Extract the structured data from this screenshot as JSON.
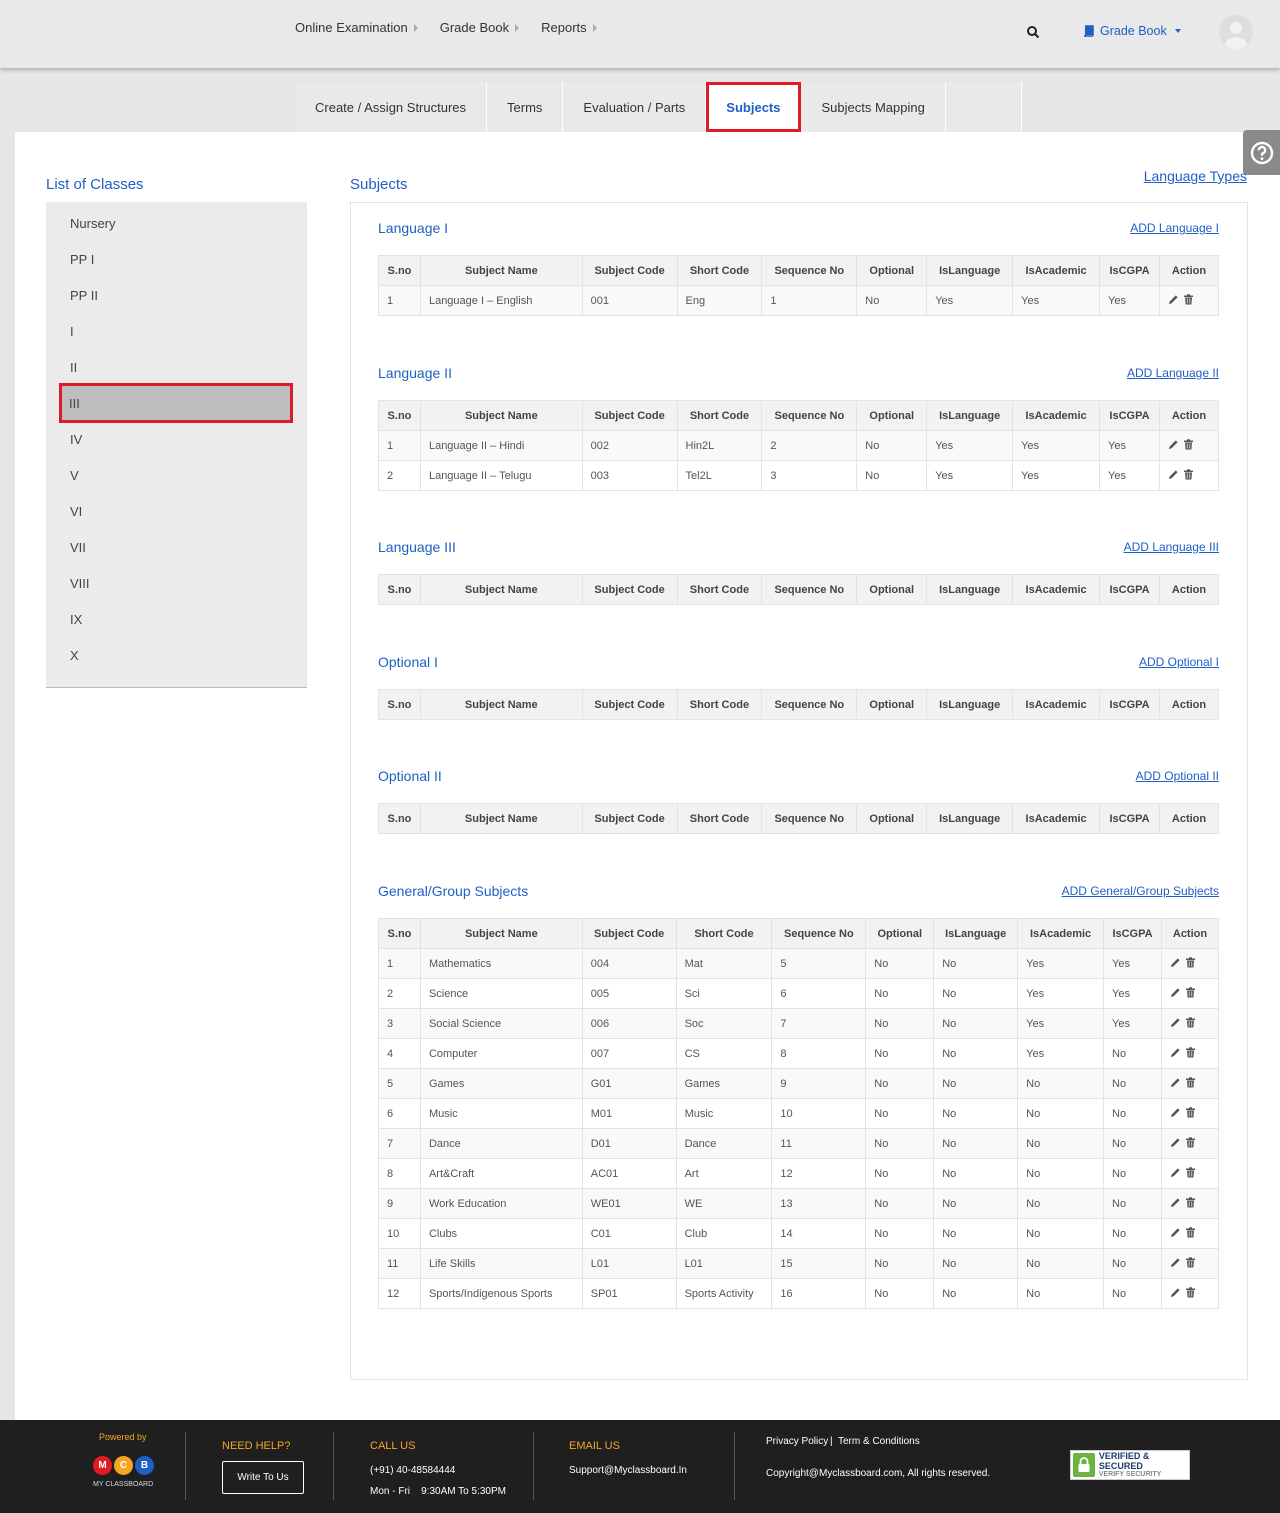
{
  "topnav": {
    "items": [
      "Online Examination",
      "Grade Book",
      "Reports"
    ],
    "gradebook_menu": "Grade Book"
  },
  "tabs": [
    "Create / Assign Structures",
    "Terms",
    "Evaluation / Parts",
    "Subjects",
    "Subjects Mapping"
  ],
  "classes": {
    "title": "List of Classes",
    "items": [
      "Nursery",
      "PP I",
      "PP II",
      "I",
      "II",
      "III",
      "IV",
      "V",
      "VI",
      "VII",
      "VIII",
      "IX",
      "X"
    ],
    "selected": "III"
  },
  "subjects": {
    "title": "Subjects",
    "language_types_link": "Language Types",
    "columns": [
      "S.no",
      "Subject Name",
      "Subject Code",
      "Short Code",
      "Sequence No",
      "Optional",
      "IsLanguage",
      "IsAcademic",
      "IsCGPA",
      "Action"
    ],
    "sections": [
      {
        "title": "Language I",
        "add_link": "ADD Language I",
        "rows": [
          [
            "1",
            "Language I – English",
            "001",
            "Eng",
            "1",
            "No",
            "Yes",
            "Yes",
            "Yes"
          ]
        ]
      },
      {
        "title": "Language II",
        "add_link": "ADD Language II",
        "rows": [
          [
            "1",
            "Language II – Hindi",
            "002",
            "Hin2L",
            "2",
            "No",
            "Yes",
            "Yes",
            "Yes"
          ],
          [
            "2",
            "Language II – Telugu",
            "003",
            "Tel2L",
            "3",
            "No",
            "Yes",
            "Yes",
            "Yes"
          ]
        ]
      },
      {
        "title": "Language III",
        "add_link": "ADD Language III",
        "rows": []
      },
      {
        "title": "Optional I",
        "add_link": "ADD Optional I",
        "rows": []
      },
      {
        "title": "Optional II",
        "add_link": "ADD Optional II",
        "rows": []
      },
      {
        "title": "General/Group Subjects",
        "add_link": "ADD General/Group Subjects",
        "rows": [
          [
            "1",
            "Mathematics",
            "004",
            "Mat",
            "5",
            "No",
            "No",
            "Yes",
            "Yes"
          ],
          [
            "2",
            "Science",
            "005",
            "Sci",
            "6",
            "No",
            "No",
            "Yes",
            "Yes"
          ],
          [
            "3",
            "Social Science",
            "006",
            "Soc",
            "7",
            "No",
            "No",
            "Yes",
            "Yes"
          ],
          [
            "4",
            "Computer",
            "007",
            "CS",
            "8",
            "No",
            "No",
            "Yes",
            "No"
          ],
          [
            "5",
            "Games",
            "G01",
            "Games",
            "9",
            "No",
            "No",
            "No",
            "No"
          ],
          [
            "6",
            "Music",
            "M01",
            "Music",
            "10",
            "No",
            "No",
            "No",
            "No"
          ],
          [
            "7",
            "Dance",
            "D01",
            "Dance",
            "11",
            "No",
            "No",
            "No",
            "No"
          ],
          [
            "8",
            "Art&Craft",
            "AC01",
            "Art",
            "12",
            "No",
            "No",
            "No",
            "No"
          ],
          [
            "9",
            "Work Education",
            "WE01",
            "WE",
            "13",
            "No",
            "No",
            "No",
            "No"
          ],
          [
            "10",
            "Clubs",
            "C01",
            "Club",
            "14",
            "No",
            "No",
            "No",
            "No"
          ],
          [
            "11",
            "Life Skills",
            "L01",
            "L01",
            "15",
            "No",
            "No",
            "No",
            "No"
          ],
          [
            "12",
            "Sports/Indigenous Sports",
            "SP01",
            "Sports Activity",
            "16",
            "No",
            "No",
            "No",
            "No"
          ]
        ]
      }
    ]
  },
  "footer": {
    "powered_by": "Powered by",
    "logo_letters": [
      "M",
      "C",
      "B"
    ],
    "logo_text": "MY CLASSBOARD",
    "need_help": "NEED HELP?",
    "write_to_us": "Write To Us",
    "call_us": "CALL US",
    "phone": "(+91) 40-48584444",
    "hours": "Mon - Fri    9:30AM To 5:30PM",
    "email_us": "EMAIL US",
    "email": "Support@Myclassboard.In",
    "privacy": "Privacy Policy",
    "terms": "Term & Conditions",
    "copyright": "Copyright@Myclassboard.com, All rights reserved.",
    "badge_line1": "VERIFIED & SECURED",
    "badge_line2": "VERIFY SECURITY"
  },
  "colors": {
    "accent": "#1f5fc6",
    "highlight": "#e01b24",
    "footer_heading": "#f5a623"
  }
}
